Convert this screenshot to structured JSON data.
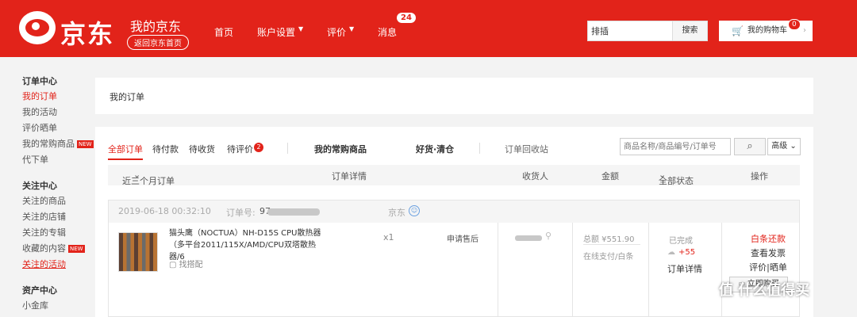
{
  "header": {
    "logo_text": "京东",
    "my_jd": "我的京东",
    "back_home": "返回京东首页",
    "nav": [
      {
        "label": "首页",
        "dropdown": false
      },
      {
        "label": "账户设置",
        "dropdown": true
      },
      {
        "label": "评价",
        "dropdown": true
      },
      {
        "label": "消息",
        "dropdown": false
      }
    ],
    "message_count": "24",
    "search_value": "排插",
    "search_button": "搜索",
    "cart_label": "我的购物车",
    "cart_count": "0"
  },
  "sidebar": {
    "groups": [
      {
        "title": "订单中心",
        "items": [
          "我的订单",
          "我的活动",
          "评价晒单",
          "我的常购商品",
          "代下单"
        ]
      },
      {
        "title": "关注中心",
        "items": [
          "关注的商品",
          "关注的店铺",
          "关注的专辑",
          "收藏的内容",
          "关注的活动"
        ]
      },
      {
        "title": "资产中心",
        "items": [
          "小金库"
        ]
      }
    ],
    "new_tag": "NEW"
  },
  "main": {
    "title": "我的订单",
    "tabs": [
      "全部订单",
      "待付款",
      "待收货",
      "待评价",
      "我的常购商品",
      "好货·清仓",
      "订单回收站"
    ],
    "review_badge": "2",
    "search_placeholder": "商品名称/商品编号/订单号",
    "advanced": "高级",
    "columns": [
      "近三个月订单",
      "订单详情",
      "收货人",
      "金额",
      "全部状态",
      "操作"
    ]
  },
  "order": {
    "datetime": "2019-06-18 00:32:10",
    "order_no_label": "订单号:",
    "order_no_prefix": "97",
    "shop": "京东",
    "product_name": "猫头鹰（NOCTUA）NH-D15S CPU散热器（多平台2011/115X/AMD/CPU双塔散热器/6",
    "find_match": "找搭配",
    "qty": "x1",
    "after_sale": "申请售后",
    "amount": "总额 ¥551.90",
    "pay_method": "在线支付/白条",
    "status": "已完成",
    "points": "+55",
    "detail": "订单详情",
    "ops": [
      "白条还款",
      "查看发票",
      "评价|晒单"
    ],
    "buy_again": "立即购买"
  },
  "watermark": "值 什么值得买",
  "colors": {
    "brand_red": "#e2231a"
  }
}
